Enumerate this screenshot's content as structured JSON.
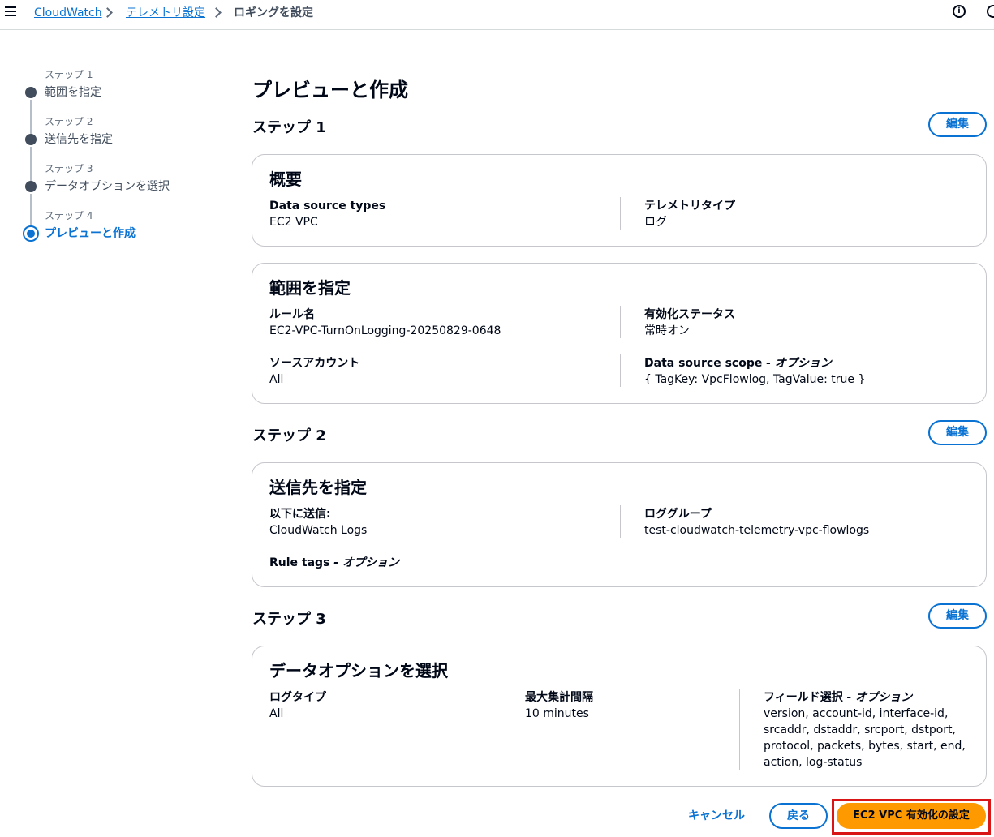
{
  "breadcrumb": {
    "items": [
      "CloudWatch",
      "テレメトリ設定"
    ],
    "current": "ロギングを設定"
  },
  "icons": {
    "menu": "hamburger-menu-icon",
    "info": "info-icon"
  },
  "steps": [
    {
      "kicker": "ステップ 1",
      "label": "範囲を指定"
    },
    {
      "kicker": "ステップ 2",
      "label": "送信先を指定"
    },
    {
      "kicker": "ステップ 3",
      "label": "データオプションを選択"
    },
    {
      "kicker": "ステップ 4",
      "label": "プレビューと作成",
      "active": true
    }
  ],
  "page_title": "プレビューと作成",
  "edit_label": "編集",
  "sections": {
    "step1": {
      "heading": "ステップ 1",
      "overview": {
        "title": "概要",
        "fields": [
          {
            "key": "Data source types",
            "value": "EC2 VPC"
          },
          {
            "key": "テレメトリタイプ",
            "value": "ログ"
          }
        ]
      },
      "scope": {
        "title": "範囲を指定",
        "fields": [
          {
            "key": "ルール名",
            "value": "EC2-VPC-TurnOnLogging-20250829-0648"
          },
          {
            "key": "有効化ステータス",
            "value": "常時オン"
          },
          {
            "key": "ソースアカウント",
            "value": "All"
          },
          {
            "key": "Data source scope",
            "key_suffix": " - オプション",
            "value": "{ TagKey: VpcFlowlog, TagValue: true }"
          }
        ]
      }
    },
    "step2": {
      "heading": "ステップ 2",
      "destination": {
        "title": "送信先を指定",
        "fields": [
          {
            "key": "以下に送信:",
            "value": "CloudWatch Logs"
          },
          {
            "key": "ロググループ",
            "value": "test-cloudwatch-telemetry-vpc-flowlogs"
          },
          {
            "key": "Rule tags",
            "key_suffix": " - オプション",
            "value": ""
          }
        ]
      }
    },
    "step3": {
      "heading": "ステップ 3",
      "data_options": {
        "title": "データオプションを選択",
        "fields": [
          {
            "key": "ログタイプ",
            "value": "All"
          },
          {
            "key": "最大集計間隔",
            "value": "10 minutes"
          },
          {
            "key": "フィールド選択",
            "key_suffix": " - オプション",
            "value_lines": [
              "version, account-id, interface-id,",
              "srcaddr, dstaddr, srcport, dstport,",
              "protocol, packets, bytes, start, end,",
              "action, log-status"
            ]
          }
        ]
      }
    }
  },
  "footer": {
    "cancel": "キャンセル",
    "back": "戻る",
    "submit": "EC2 VPC 有効化の設定"
  },
  "colors": {
    "accent": "#0972d3",
    "primary": "#ff9900",
    "highlight": "#d91515"
  }
}
